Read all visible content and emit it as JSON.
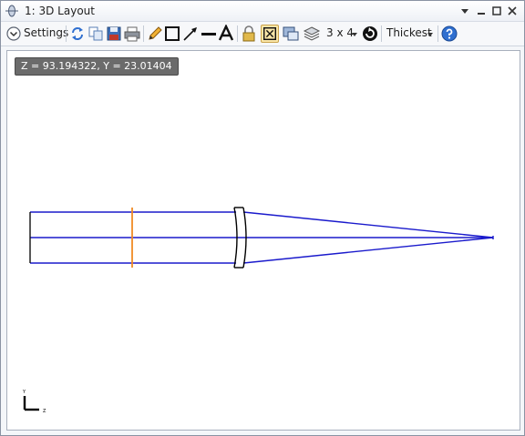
{
  "window": {
    "title": "1: 3D Layout",
    "app_icon": "zemax-lens-icon"
  },
  "toolbar": {
    "settings_label": "Settings",
    "config_label": "3 x 4",
    "line_width_label": "Thickest",
    "icons": [
      "settings-chevron-icon",
      "refresh-icon",
      "copy-icon",
      "save-icon",
      "print-icon",
      "pencil-icon",
      "rectangle-icon",
      "arrow-icon",
      "line-icon",
      "text-icon",
      "lock-icon",
      "fit-view-icon",
      "window-icon",
      "layers-icon",
      "rotate-icon",
      "help-icon"
    ]
  },
  "canvas": {
    "cursor_readout": "Z = 93.194322, Y = 23.01404",
    "axis_labels": {
      "y": "Y",
      "z": "Z"
    }
  },
  "colors": {
    "ray": "#1a1acc",
    "stop": "#f08a24",
    "lens": "#000000",
    "accent": "#f0c860"
  }
}
